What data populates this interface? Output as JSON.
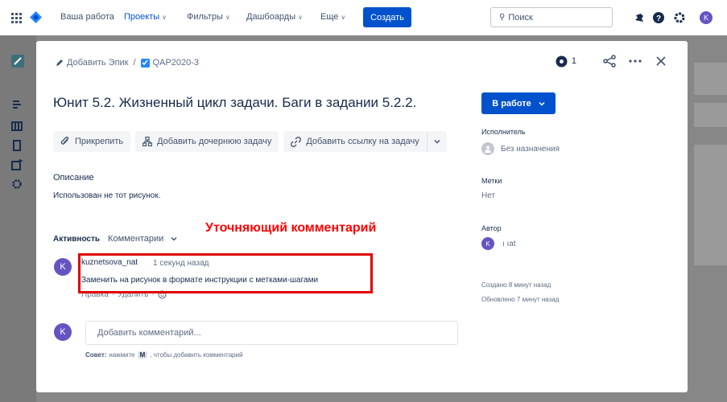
{
  "topnav": {
    "your_work": "Ваша работа",
    "projects": "Проекты",
    "filters": "Фильтры",
    "dashboards": "Дашбоарды",
    "more": "Еще",
    "create": "Создать",
    "search_placeholder": "Поиск",
    "avatar_initial": "K"
  },
  "issue": {
    "breadcrumb_epic": "Добавить Эпик",
    "breadcrumb_sep": "/",
    "key": "QAP2020-3",
    "watchers": "1",
    "title": "Юнит 5.2. Жизненный цикл задачи. Баги в задании 5.2.2.",
    "actions": {
      "attach": "Прикрепить",
      "add_child": "Добавить дочернюю задачу",
      "add_link": "Добавить ссылку на задачу"
    },
    "description_label": "Описание",
    "description_text": "Использован не тот рисунок.",
    "activity_label": "Активность",
    "activity_filter": "Комментарии"
  },
  "annotation": "Уточняющий комментарий",
  "comment": {
    "avatar_initial": "K",
    "author": "kuznetsova_nat",
    "time": "1 секунд назад",
    "body": "Заменить на рисунок в формате инструкции с метками-шагами",
    "edit": "Правка",
    "delete": "Удалить",
    "dot": "·"
  },
  "new_comment": {
    "avatar_initial": "K",
    "placeholder": "Добавить комментарий...",
    "hint_prefix": "Совет:",
    "hint_before": "нажмите",
    "hint_key": "M",
    "hint_after": ", чтобы добавить комментарий"
  },
  "panel": {
    "status": "В работе",
    "assignee_label": "Исполнитель",
    "assignee_value": "Без назначения",
    "labels_label": "Метки",
    "labels_value": "Нет",
    "author_label": "Автор",
    "author_initial": "K",
    "author_name": "ı                  ıat",
    "created": "Создано 8 минут назад",
    "updated": "Обновлено 7 минут назад"
  },
  "colors": {
    "primary": "#0052cc",
    "avatar": "#6554c0",
    "annotation": "#ff0000"
  }
}
